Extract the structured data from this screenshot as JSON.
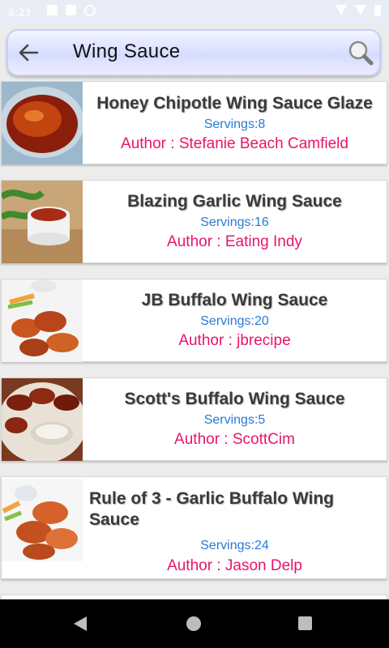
{
  "status_bar": {
    "time": "6:23"
  },
  "search": {
    "query": "Wing Sauce"
  },
  "recipes": [
    {
      "title": "Honey Chipotle Wing Sauce Glaze",
      "servings": "Servings:8",
      "author": "Author : Stefanie Beach Camfield"
    },
    {
      "title": "Blazing Garlic Wing Sauce",
      "servings": "Servings:16",
      "author": "Author : Eating Indy"
    },
    {
      "title": "JB Buffalo Wing Sauce",
      "servings": "Servings:20",
      "author": "Author : jbrecipe"
    },
    {
      "title": "Scott's Buffalo Wing Sauce",
      "servings": "Servings:5",
      "author": "Author : ScottCim"
    },
    {
      "title": "Rule of 3 - Garlic Buffalo Wing Sauce",
      "servings": "Servings:24",
      "author": "Author : Jason Delp"
    }
  ]
}
